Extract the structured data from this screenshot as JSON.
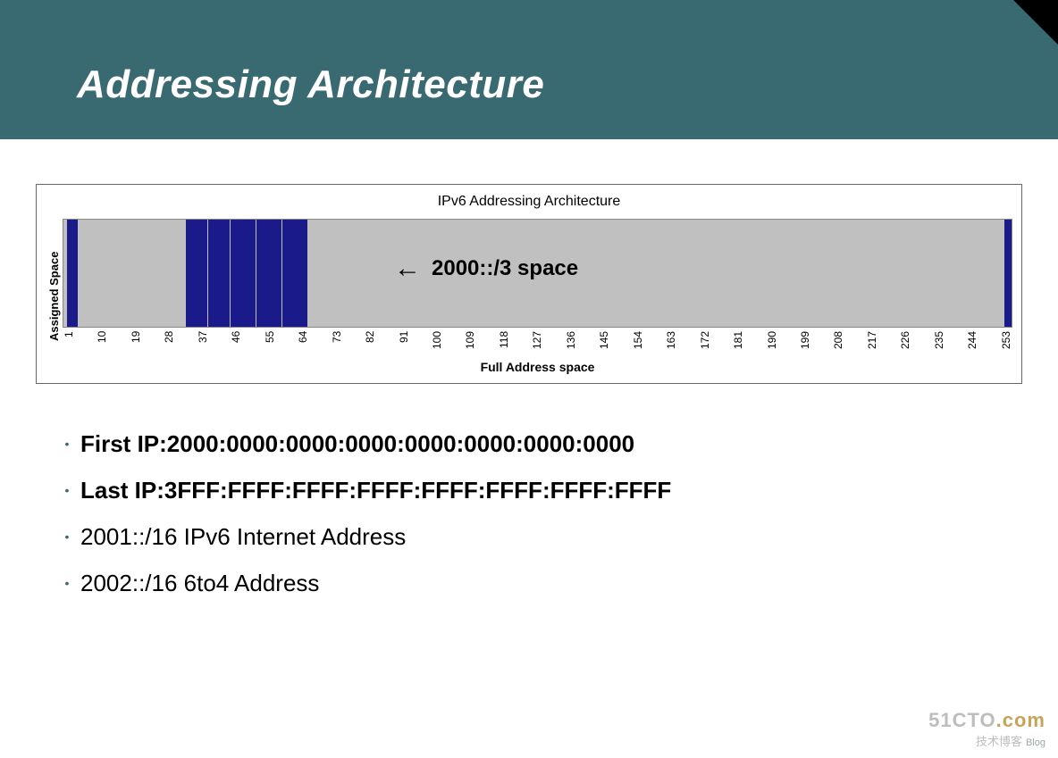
{
  "header": {
    "title": "Addressing Architecture"
  },
  "chart_data": {
    "type": "bar",
    "title": "IPv6 Addressing Architecture",
    "ylabel": "Assigned Space",
    "xlabel": "Full Address space",
    "annotation": "2000::/3 space",
    "xticks": [
      1,
      10,
      19,
      28,
      37,
      46,
      55,
      64,
      73,
      82,
      91,
      100,
      109,
      118,
      127,
      136,
      145,
      154,
      163,
      172,
      181,
      190,
      199,
      208,
      217,
      226,
      235,
      244,
      253
    ],
    "bars_dense_ranges": [
      [
        1,
        3
      ],
      [
        33,
        65
      ],
      [
        254,
        255
      ]
    ]
  },
  "bullets": [
    {
      "bold": true,
      "text": "First IP:2000:0000:0000:0000:0000:0000:0000:0000"
    },
    {
      "bold": true,
      "text": "Last IP:3FFF:FFFF:FFFF:FFFF:FFFF:FFFF:FFFF:FFFF"
    },
    {
      "bold": false,
      "text": "2001::/16  IPv6 Internet Address"
    },
    {
      "bold": false,
      "text": "2002::/16  6to4 Address"
    }
  ],
  "watermark": {
    "line1a": "51CTO",
    "line1b": ".com",
    "line2a": "技术博客",
    "line2b": "Blog"
  }
}
